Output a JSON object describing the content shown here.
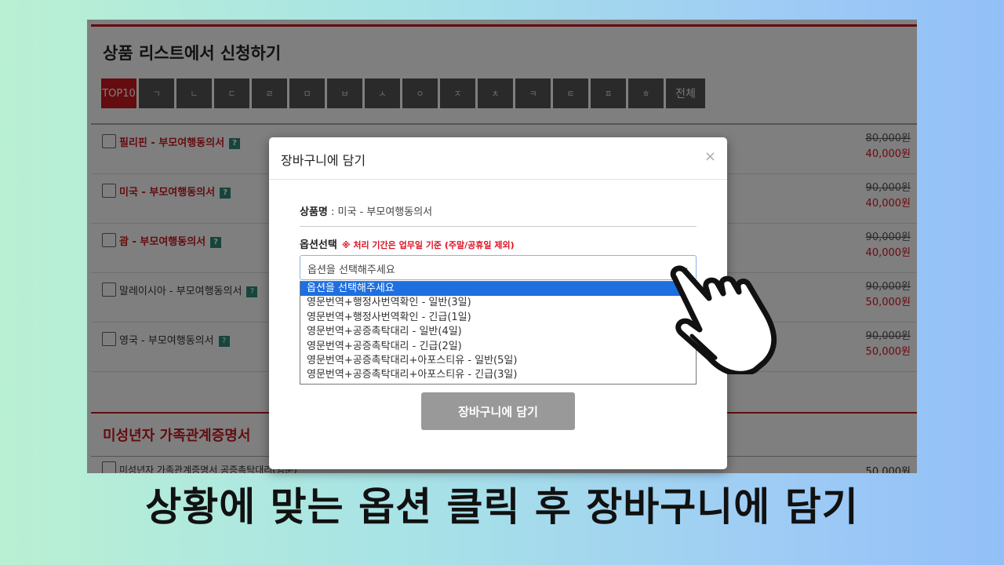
{
  "section": {
    "title": "상품 리스트에서 신청하기"
  },
  "index_tabs": [
    "TOP10",
    "ㄱ",
    "ㄴ",
    "ㄷ",
    "ㄹ",
    "ㅁ",
    "ㅂ",
    "ㅅ",
    "ㅇ",
    "ㅈ",
    "ㅊ",
    "ㅋ",
    "ㅌ",
    "ㅍ",
    "ㅎ",
    "전체"
  ],
  "products": [
    {
      "name": "필리핀 - 부모여행동의서",
      "old_price": "80,000원",
      "new_price": "40,000원"
    },
    {
      "name": "미국 - 부모여행동의서",
      "old_price": "90,000원",
      "new_price": "40,000원"
    },
    {
      "name": "괌 - 부모여행동의서",
      "old_price": "90,000원",
      "new_price": "40,000원"
    },
    {
      "name": "말레이시아 - 부모여행동의서",
      "old_price": "90,000원",
      "new_price": "50,000원"
    },
    {
      "name": "영국 - 부모여행동의서",
      "old_price": "90,000원",
      "new_price": "50,000원"
    }
  ],
  "help_icon": "?",
  "section2": {
    "title": "미성년자 가족관계증명서",
    "row_text": "미성년자 가족관계증명서 공증촉탁대리(영문)",
    "row_price": "50,000원"
  },
  "modal": {
    "title": "장바구니에 담기",
    "close": "×",
    "product_label": "상품명",
    "product_value": " : 미국 - 부모여행동의서",
    "option_label": "옵션선택",
    "option_note": "※ 처리 기간은 업무일 기준 (주말/공휴일 제외)",
    "select_value": "옵션을 선택해주세요",
    "select_chevron": "⌄",
    "options": [
      "옵션을 선택해주세요",
      "영문번역+행정사번역확인 - 일반(3일)",
      "영문번역+행정사번역확인 - 긴급(1일)",
      "영문번역+공증촉탁대리 - 일반(4일)",
      "영문번역+공증촉탁대리 - 긴급(2일)",
      "영문번역+공증촉탁대리+아포스티유 - 일반(5일)",
      "영문번역+공증촉탁대리+아포스티유 - 긴급(3일)"
    ],
    "selected_index": 0,
    "submit_label": "장바구니에 담기"
  },
  "caption": "상황에 맞는 옵션 클릭 후 장바구니에 담기",
  "icons": {
    "pointer": "hand-pointer-icon"
  },
  "colors": {
    "brand_red": "#c8191e",
    "selected_blue": "#1e6fe0"
  }
}
